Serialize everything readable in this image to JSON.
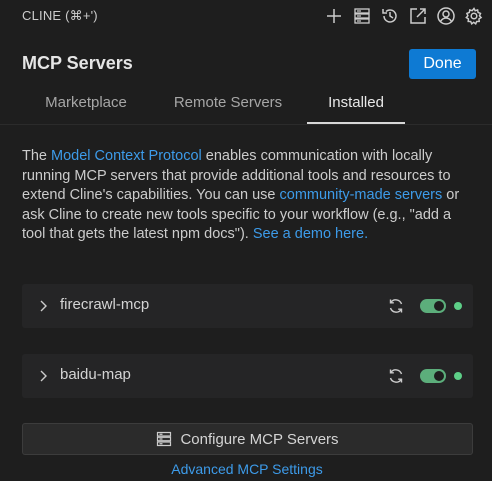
{
  "app": {
    "title": "CLINE (⌘+')"
  },
  "toolbar": {
    "icons": [
      "plus-icon",
      "server-list-icon",
      "history-icon",
      "popout-icon",
      "account-icon",
      "gear-icon"
    ]
  },
  "header": {
    "title": "MCP Servers",
    "done_label": "Done"
  },
  "tabs": [
    {
      "label": "Marketplace",
      "active": false
    },
    {
      "label": "Remote Servers",
      "active": false
    },
    {
      "label": "Installed",
      "active": true
    }
  ],
  "description": {
    "t1": "The ",
    "link1": "Model Context Protocol",
    "t2": " enables communication with locally running MCP servers that provide additional tools and resources to extend Cline's capabilities. You can use ",
    "link2": "community-made servers",
    "t3": " or ask Cline to create new tools specific to your workflow (e.g., \"add a tool that gets the latest npm docs\"). ",
    "link3": "See a demo here."
  },
  "servers": [
    {
      "name": "firecrawl-mcp",
      "enabled": true,
      "status_color": "#5dcf87"
    },
    {
      "name": "baidu-map",
      "enabled": true,
      "status_color": "#5dcf87"
    }
  ],
  "footer": {
    "configure_label": "Configure MCP Servers",
    "advanced_label": "Advanced MCP Settings"
  },
  "colors": {
    "accent": "#0e7ad3",
    "link": "#3d9be9",
    "toggle_on": "#5cae7b",
    "status_ok": "#5dcf87"
  }
}
